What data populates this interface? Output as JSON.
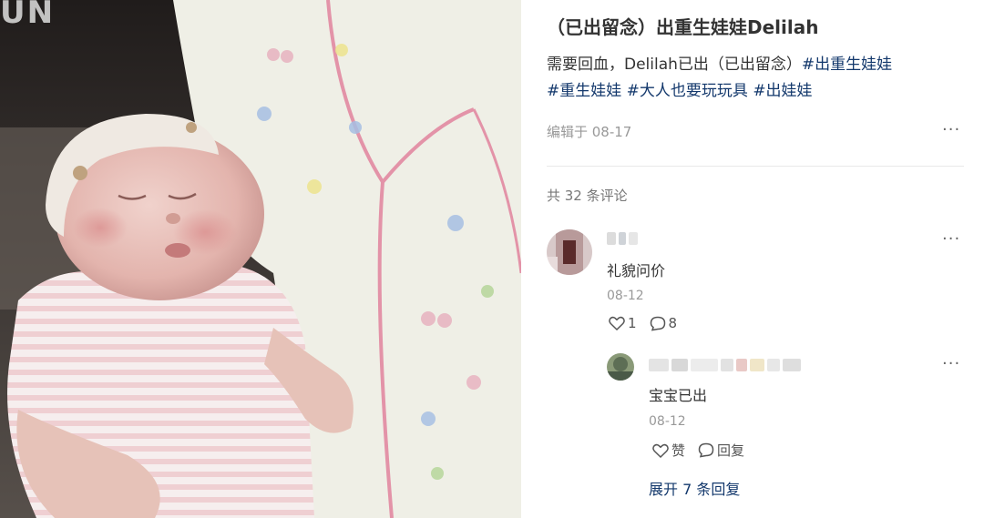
{
  "photo": {
    "watermark": "UN"
  },
  "post": {
    "title": "（已出留念）出重生娃娃Delilah",
    "description": "需要回血，Delilah已出（已出留念）",
    "tags": [
      "#出重生娃娃",
      "#重生娃娃",
      "#大人也要玩玩具",
      "#出娃娃"
    ],
    "edited": "编辑于 08-17",
    "more_glyph": "···"
  },
  "comments": {
    "count_label": "共 32 条评论",
    "top": {
      "text": "礼貌问价",
      "date": "08-12",
      "likes": "1",
      "replies": "8"
    },
    "reply": {
      "text": "宝宝已出",
      "date": "08-12",
      "like_label": "赞",
      "reply_label": "回复"
    },
    "expand_label": "展开 7 条回复"
  },
  "colors": {
    "tag": "#13386c",
    "muted": "#999999",
    "divider": "#e8e8e8"
  },
  "icons": {
    "like": "heart-outline-icon",
    "reply": "speech-bubble-icon",
    "more": "more-dots-icon"
  }
}
